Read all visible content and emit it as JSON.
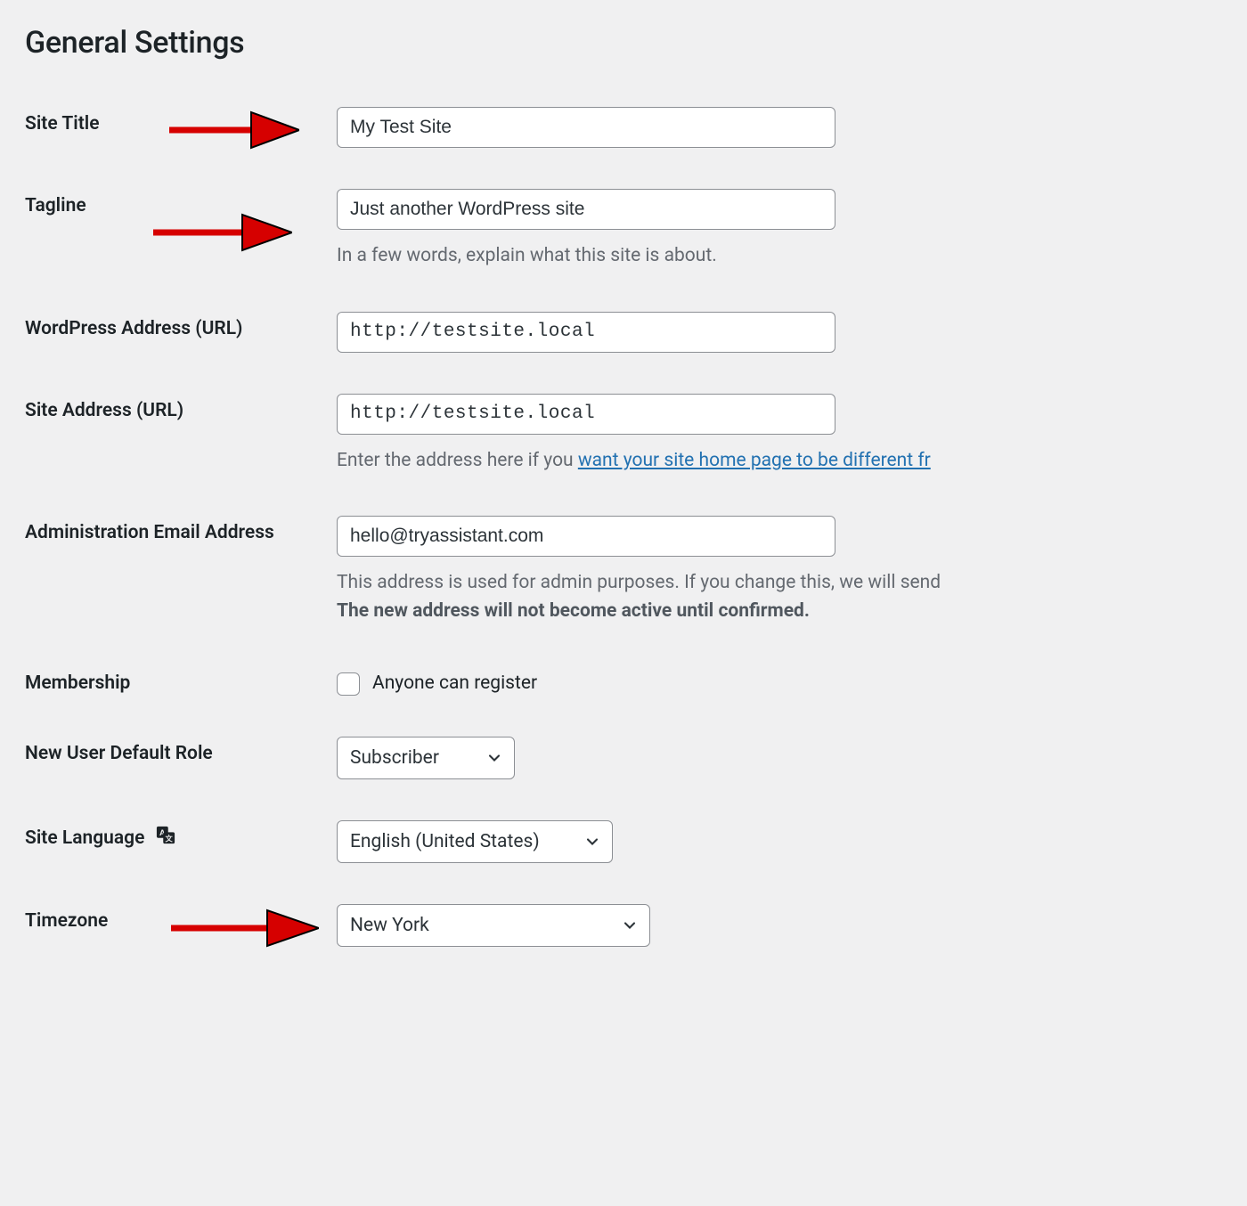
{
  "page": {
    "title": "General Settings"
  },
  "fields": {
    "site_title": {
      "label": "Site Title",
      "value": "My Test Site"
    },
    "tagline": {
      "label": "Tagline",
      "value": "Just another WordPress site",
      "help": "In a few words, explain what this site is about."
    },
    "wp_url": {
      "label": "WordPress Address (URL)",
      "value": "http://testsite.local"
    },
    "site_url": {
      "label": "Site Address (URL)",
      "value": "http://testsite.local",
      "help_pre": "Enter the address here if you ",
      "help_link": "want your site home page to be different fr"
    },
    "admin_email": {
      "label": "Administration Email Address",
      "value": "hello@tryassistant.com",
      "help_line1": "This address is used for admin purposes. If you change this, we will send",
      "help_line2": "The new address will not become active until confirmed."
    },
    "membership": {
      "label": "Membership",
      "checkbox_label": "Anyone can register",
      "checked": false
    },
    "default_role": {
      "label": "New User Default Role",
      "value": "Subscriber"
    },
    "site_language": {
      "label": "Site Language",
      "value": "English (United States)"
    },
    "timezone": {
      "label": "Timezone",
      "value": "New York"
    }
  },
  "icons": {
    "chevron_down": "chevron-down-icon",
    "translate": "translate-icon",
    "arrow": "arrow-right-icon"
  },
  "colors": {
    "bg": "#f0f0f1",
    "text": "#1d2327",
    "muted": "#646970",
    "border": "#8c8f94",
    "link": "#2271b1",
    "arrow": "#d60000"
  }
}
